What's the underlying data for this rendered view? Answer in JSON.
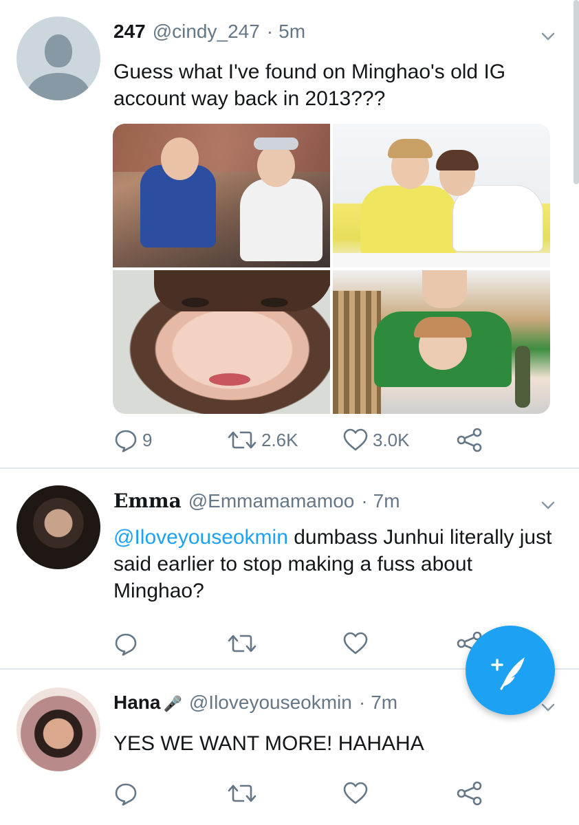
{
  "tweets": [
    {
      "name": "247",
      "handle": "@cindy_247",
      "separator": "·",
      "time": "5m",
      "text": "Guess what I've found on Minghao's old IG account way back in 2013???",
      "replies": "9",
      "retweets": "2.6K",
      "likes": "3.0K"
    },
    {
      "name": "Emma",
      "handle": "@Emmamamamoo",
      "separator": "·",
      "time": "7m",
      "mention": "@Iloveyouseokmin",
      "text": " dumbass Junhui literally just said earlier to stop making a fuss about Minghao?",
      "replies": "",
      "retweets": "",
      "likes": ""
    },
    {
      "name": "Hana",
      "name_emoji": "🎤",
      "handle": "@Iloveyouseokmin",
      "separator": "·",
      "time": "7m",
      "text": "YES WE WANT MORE! HAHAHA",
      "replies": "",
      "retweets": "",
      "likes": ""
    }
  ],
  "colors": {
    "accent": "#1da1f2",
    "secondary_text": "#657786",
    "separator": "#e1e8ed"
  },
  "icons": {
    "reply": "reply-icon",
    "retweet": "retweet-icon",
    "like": "heart-icon",
    "share": "share-icon",
    "more": "chevron-down-icon",
    "compose": "compose-tweet-icon"
  }
}
